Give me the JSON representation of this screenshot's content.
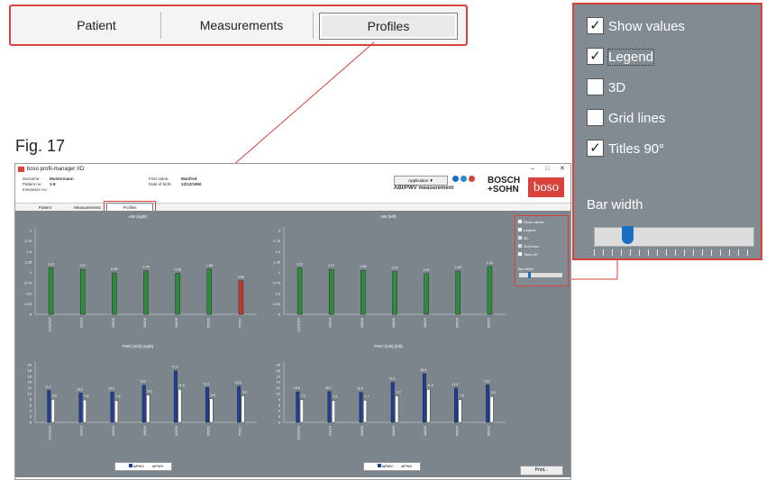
{
  "zoom_tabs": {
    "patient": "Patient",
    "measurements": "Measurements",
    "profiles": "Profiles"
  },
  "zoom_options": {
    "items": [
      {
        "label": "Show values",
        "checked": true
      },
      {
        "label": "Legend",
        "checked": true
      },
      {
        "label": "3D",
        "checked": false
      },
      {
        "label": "Grid lines",
        "checked": false
      },
      {
        "label": "Titles 90°",
        "checked": true
      }
    ],
    "bar_width_label": "Bar width",
    "bar_width_level": 0.17
  },
  "figure_label": "Fig. 17",
  "window": {
    "title": "boso profil-manager XD",
    "controls": {
      "minimize": "–",
      "maximize": "□",
      "close": "✕"
    },
    "patient_info": {
      "surname_label": "Surname:",
      "surname": "Mustermann",
      "first_name_label": "First name:",
      "first_name": "Manfred",
      "patient_no_label": "Patient no.:",
      "patient_no": "1-8",
      "dob_label": "Date of birth:",
      "dob": "12/12/1950",
      "insurance_label": "Insurance no.:"
    },
    "application_button": "Application ▼",
    "measurement_title": "ABI/PWV measurement",
    "brand_line1": "BOSCH",
    "brand_line2": "+SOHN",
    "brand_logo": "boso",
    "tabs": {
      "patient": "Patient",
      "measurements": "Measurements",
      "profiles": "Profiles"
    },
    "options": {
      "items": [
        {
          "label": "Show values",
          "checked": true
        },
        {
          "label": "Legend",
          "checked": true
        },
        {
          "label": "3D",
          "checked": false
        },
        {
          "label": "Grid lines",
          "checked": false
        },
        {
          "label": "Titles 90°",
          "checked": true
        }
      ],
      "bar_width_label": "Bar width"
    },
    "legend": {
      "la": "laPWV",
      "el": "elPWV"
    },
    "print_button": "Print..."
  },
  "colors": {
    "green": "#2f8a3c",
    "red": "#c0392b",
    "blue": "#1d3f9b",
    "white": "#ffffff",
    "accent": "#d9423a",
    "plot_bg": "#7d858c"
  },
  "chart_data": [
    {
      "type": "bar",
      "title": "ABI (right)",
      "ylim": [
        0,
        2
      ],
      "yticks": [
        "2",
        "1.75",
        "1.5",
        "1.25",
        "1",
        "0.75",
        "0.5",
        "0.25",
        "0"
      ],
      "categories": [
        "12/12/13",
        "1/1/13",
        "1/6/16",
        "1/6/16",
        "1/6/16",
        "5/5/15",
        "7/7/17"
      ],
      "values": [
        1.11,
        1.07,
        0.99,
        1.04,
        0.98,
        1.08,
        0.8
      ],
      "bar_colors": [
        "green",
        "green",
        "green",
        "green",
        "green",
        "green",
        "red"
      ]
    },
    {
      "type": "bar",
      "title": "ABI (left)",
      "ylim": [
        0,
        2
      ],
      "yticks": [
        "2",
        "1.75",
        "1.5",
        "1.25",
        "1",
        "0.75",
        "0.5",
        "0.25",
        "0"
      ],
      "categories": [
        "12/12/13",
        "1/1/13",
        "1/6/16",
        "1/6/16",
        "1/6/16",
        "5/5/15",
        "5/5/15"
      ],
      "values": [
        1.11,
        1.07,
        1.05,
        1.02,
        0.97,
        1.03,
        1.14
      ],
      "bar_colors": [
        "green",
        "green",
        "green",
        "green",
        "green",
        "green",
        "green"
      ]
    },
    {
      "type": "bar",
      "title": "PWV [m/s] (right)",
      "ylim": [
        0,
        20
      ],
      "yticks": [
        "20",
        "18",
        "16",
        "14",
        "12",
        "10",
        "8",
        "6",
        "4",
        "2",
        "0"
      ],
      "categories": [
        "12/12/13",
        "1/1/13",
        "1/6/16",
        "1/6/16",
        "1/6/16",
        "5/5/15",
        "7/7/17"
      ],
      "series": [
        {
          "name": "laPWV",
          "values": [
            11.1,
            10.2,
            10.5,
            12.9,
            17.9,
            12.1,
            12.5
          ]
        },
        {
          "name": "elPWV",
          "values": [
            8.0,
            7.8,
            7.6,
            9.5,
            11.5,
            8.2,
            9.2
          ]
        }
      ]
    },
    {
      "type": "bar",
      "title": "PWV [m/s] (left)",
      "ylim": [
        0,
        20
      ],
      "yticks": [
        "20",
        "18",
        "16",
        "14",
        "12",
        "10",
        "8",
        "6",
        "4",
        "2",
        "0"
      ],
      "categories": [
        "12/12/13",
        "1/1/13",
        "1/6/16",
        "1/6/16",
        "1/6/16",
        "5/5/15",
        "5/5/15"
      ],
      "series": [
        {
          "name": "laPWV",
          "values": [
            10.6,
            10.7,
            10.4,
            13.9,
            16.9,
            11.9,
            13.0
          ]
        },
        {
          "name": "elPWV",
          "values": [
            7.9,
            7.6,
            7.7,
            9.2,
            11.5,
            7.9,
            9.0
          ]
        }
      ]
    }
  ]
}
